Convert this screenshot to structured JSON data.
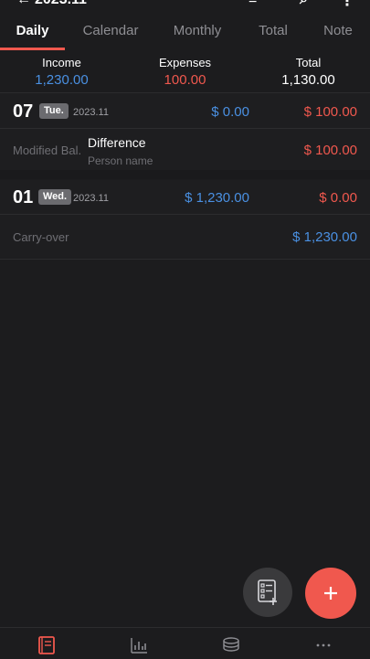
{
  "header": {
    "title": "2023.11"
  },
  "tabs": [
    {
      "label": "Daily",
      "active": true
    },
    {
      "label": "Calendar",
      "active": false
    },
    {
      "label": "Monthly",
      "active": false
    },
    {
      "label": "Total",
      "active": false
    },
    {
      "label": "Note",
      "active": false
    }
  ],
  "summary": {
    "income_label": "Income",
    "income_value": "1,230.00",
    "expenses_label": "Expenses",
    "expenses_value": "100.00",
    "total_label": "Total",
    "total_value": "1,130.00"
  },
  "days": [
    {
      "day": "07",
      "weekday": "Tue.",
      "year_month": "2023.11",
      "income": "$ 0.00",
      "expense": "$ 100.00",
      "entry": {
        "category": "Modified Bal.",
        "title": "Difference",
        "subtitle": "Person name",
        "amount": "$ 100.00"
      }
    },
    {
      "day": "01",
      "weekday": "Wed.",
      "year_month": "2023.11",
      "income": "$ 1,230.00",
      "expense": "$ 0.00",
      "entry": {
        "category": "Carry-over",
        "amount": "$ 1,230.00"
      }
    }
  ],
  "colors": {
    "accent": "#f0584e",
    "income": "#4a90e2",
    "expense": "#f0584e",
    "background": "#1c1c1e"
  },
  "fabs": {
    "template": "list-add-icon",
    "add": "plus-icon"
  },
  "bottom_nav": [
    "book-icon",
    "chart-icon",
    "coins-icon",
    "more-icon"
  ]
}
